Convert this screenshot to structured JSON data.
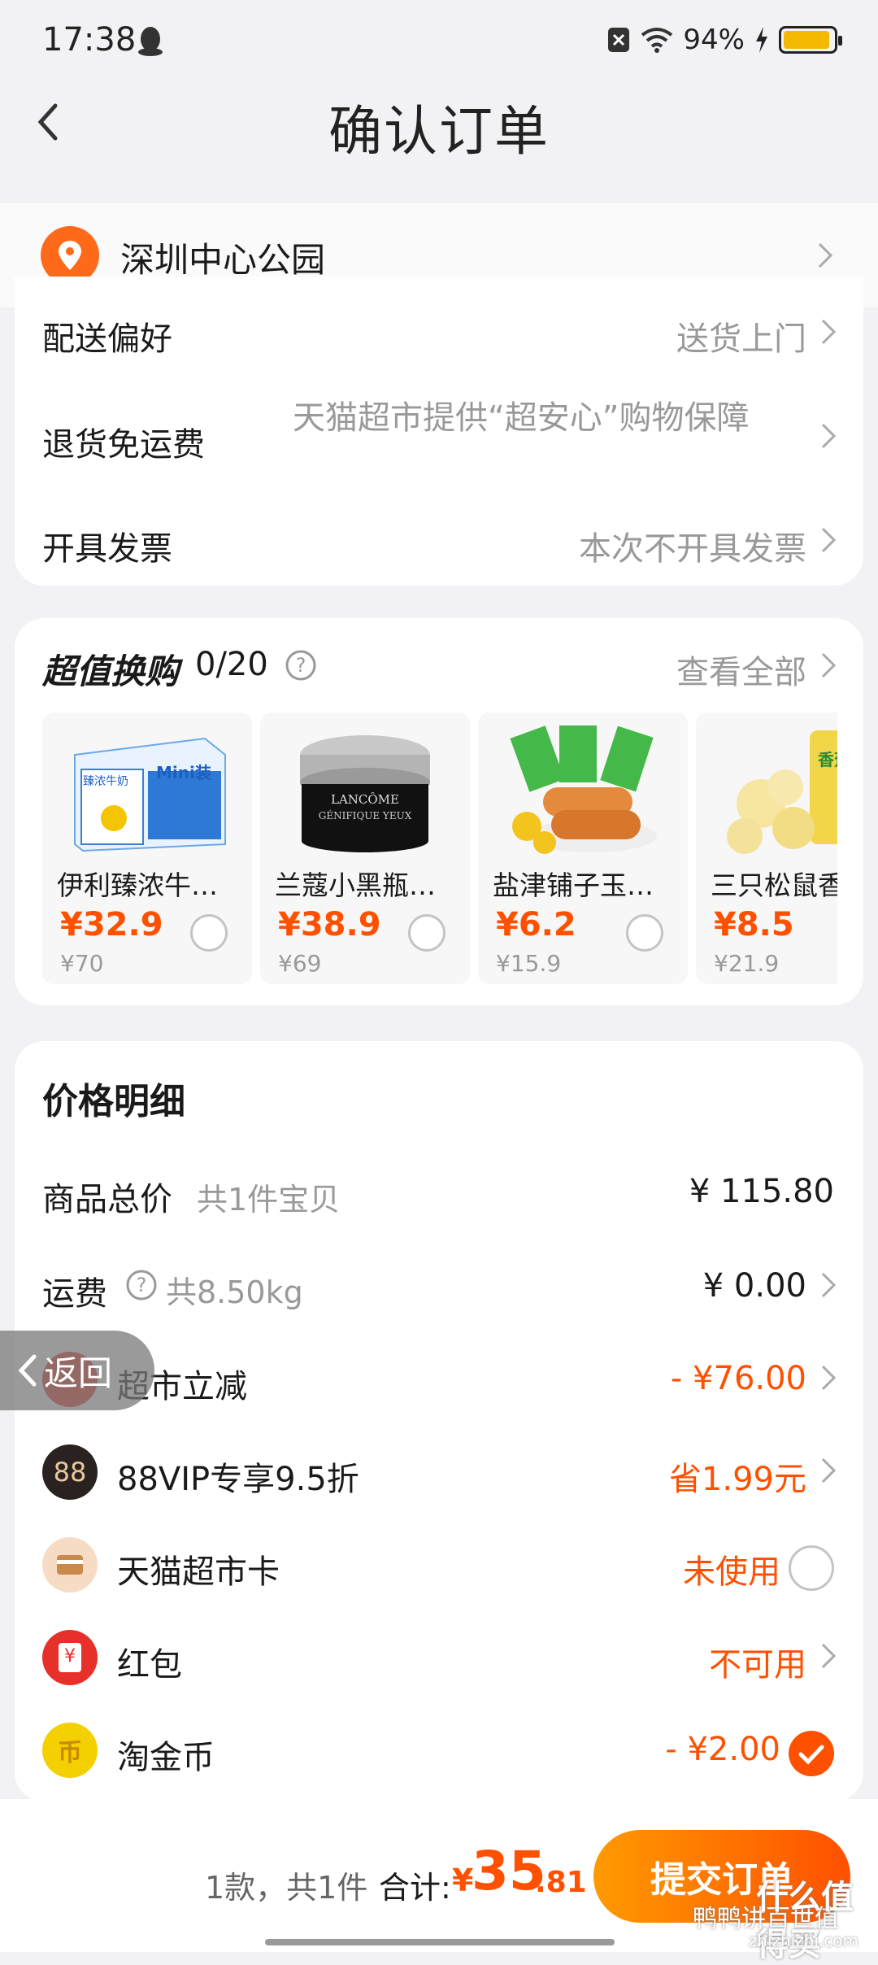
{
  "status_bar": {
    "time": "17:38",
    "battery": "94%",
    "battery_level": 0.94
  },
  "header": {
    "title": "确认订单"
  },
  "address": {
    "text": "深圳中心公园"
  },
  "delivery": {
    "rows": [
      {
        "label": "配送偏好",
        "value": "送货上门"
      },
      {
        "label": "退货免运费",
        "value": "天猫超市提供“超安心”购物保障"
      },
      {
        "label": "开具发票",
        "value": "本次不开具发票"
      }
    ]
  },
  "deals": {
    "title": "超值换购",
    "count": "0/20",
    "view_all": "查看全部",
    "items": [
      {
        "name": "伊利臻浓牛…",
        "price": "¥32.9",
        "orig": "¥70",
        "img_text": "Mini装",
        "img_sub": "臻浓牛奶"
      },
      {
        "name": "兰蔻小黑瓶…",
        "price": "¥38.9",
        "orig": "¥69",
        "img_text": "LANCÔME",
        "img_sub": "GÉNIFIQUE YEUX"
      },
      {
        "name": "盐津铺子玉…",
        "price": "¥6.2",
        "orig": "¥15.9"
      },
      {
        "name": "三只松鼠香",
        "price": "¥8.5",
        "orig": "¥21.9",
        "img_text": "香蕉"
      }
    ]
  },
  "price_detail": {
    "title": "价格明细",
    "total": {
      "label": "商品总价",
      "sub": "共1件宝贝",
      "value": "¥ 115.80"
    },
    "shipping": {
      "label": "运费",
      "sub": "共8.50kg",
      "value": "¥ 0.00"
    },
    "discount": {
      "label": "超市立减",
      "value": "- ¥76.00"
    },
    "vip": {
      "label": "88VIP专享9.5折",
      "value": "省1.99元",
      "badge": "88"
    },
    "card": {
      "label": "天猫超市卡",
      "value": "未使用"
    },
    "redpacket": {
      "label": "红包",
      "value": "不可用",
      "badge": "¥"
    },
    "coin": {
      "label": "淘金币",
      "value": "- ¥2.00",
      "badge": "币"
    }
  },
  "bottom": {
    "count": "1款，共1件",
    "total_label": "合计:",
    "currency": "¥",
    "amount_int": "35",
    "amount_dec": ".81",
    "submit": "提交订单"
  },
  "float_back": "返回",
  "watermark": {
    "main": "什么值得买",
    "sub": "zhizhizhi.com",
    "overlay": "鸭鸭讲百世值"
  },
  "colors": {
    "accent": "#ff5000",
    "gradient_start": "#ff9a00"
  }
}
